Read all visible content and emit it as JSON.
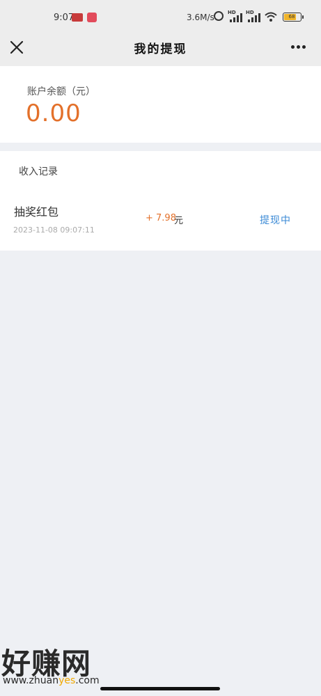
{
  "status_bar": {
    "time": "9:07",
    "network_speed": "3.6M/s",
    "battery_level": "68",
    "hd_label": "HD"
  },
  "nav": {
    "title": "我的提现"
  },
  "balance": {
    "label": "账户余额（元）",
    "amount": "0.00"
  },
  "records": {
    "section_title": "收入记录",
    "items": [
      {
        "name": "抽奖红包",
        "time": "2023-11-08 09:07:11",
        "amount": "+ 7.98",
        "unit": "元",
        "status": "提现中"
      }
    ]
  },
  "watermark": {
    "brand": "好赚网",
    "url_prefix": "www.zhuan",
    "url_highlight": "yes",
    "url_suffix": ".com"
  },
  "colors": {
    "accent_orange": "#e3702a",
    "status_blue": "#3b8ad6",
    "page_background": "#eef0f4"
  }
}
